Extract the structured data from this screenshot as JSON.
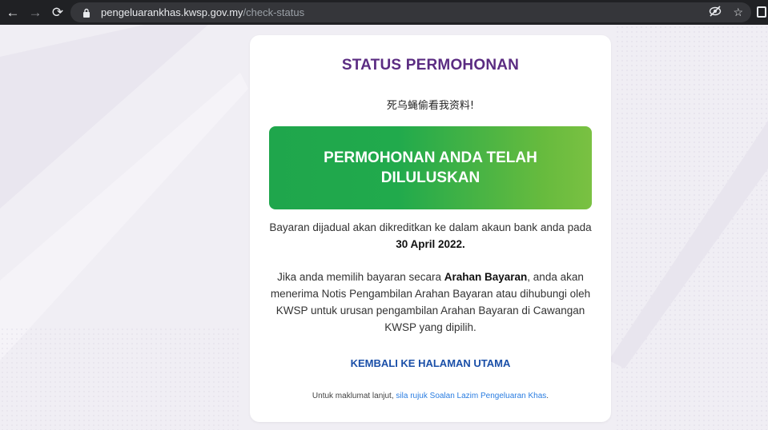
{
  "browser": {
    "back_icon": "←",
    "forward_icon": "→",
    "reload_icon": "⟳",
    "url_host": "pengeluarankhas.kwsp.gov.my",
    "url_path": "/check-status",
    "tracking_icon": "⊘",
    "bookmark_icon": "☆"
  },
  "card": {
    "title": "STATUS PERMOHONAN",
    "subtitle": "死乌蝇偷看我资料!",
    "banner": "PERMOHONAN ANDA TELAH DILULUSKAN",
    "para1_text": "Bayaran dijadual akan dikreditkan ke dalam akaun bank anda pada",
    "para1_date": "30 April 2022.",
    "para2_pre": "Jika anda memilih bayaran secara ",
    "para2_bold": "Arahan Bayaran",
    "para2_post": ", anda akan menerima Notis Pengambilan Arahan Bayaran atau dihubungi oleh KWSP untuk urusan pengambilan Arahan Bayaran di Cawangan KWSP yang dipilih.",
    "back_link": "KEMBALI KE HALAMAN UTAMA",
    "footer_pre": "Untuk maklumat lanjut, ",
    "footer_link": "sila rujuk Soalan Lazim Pengeluaran Khas",
    "footer_post": "."
  },
  "colors": {
    "title": "#5b2c82",
    "banner_start": "#1fa64c",
    "banner_end": "#7ac142",
    "link": "#1a4fa8"
  }
}
